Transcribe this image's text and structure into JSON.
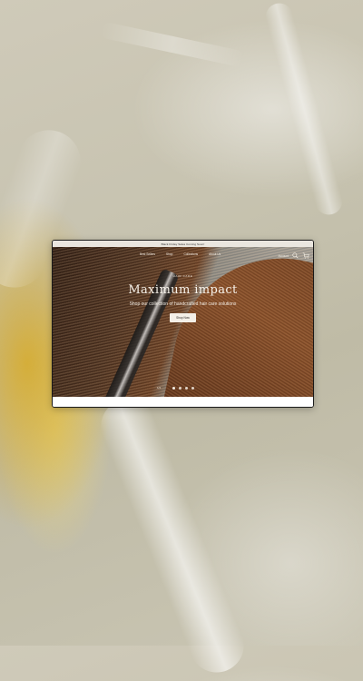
{
  "announcement": "Black Friday Sales Coming Soon!",
  "nav": {
    "links": [
      "Best Sellers",
      "Shop",
      "Collections",
      "About Us"
    ],
    "account": "Account",
    "icons": [
      "search-icon",
      "cart-icon"
    ]
  },
  "hero": {
    "eyebrow": "HAIR CARE",
    "headline": "Maximum impact",
    "subheadline": "Shop our collection of handcrafted hair care solutions",
    "cta": "Shop Now",
    "counter": "1/4"
  },
  "carousel": {
    "slides": 4,
    "active_index": 0
  },
  "colors": {
    "announcement_bg": "#eae6df",
    "hero_text": "#f7f2ea",
    "button_bg": "#f4efe7",
    "frame_border": "#1a1a1a"
  }
}
